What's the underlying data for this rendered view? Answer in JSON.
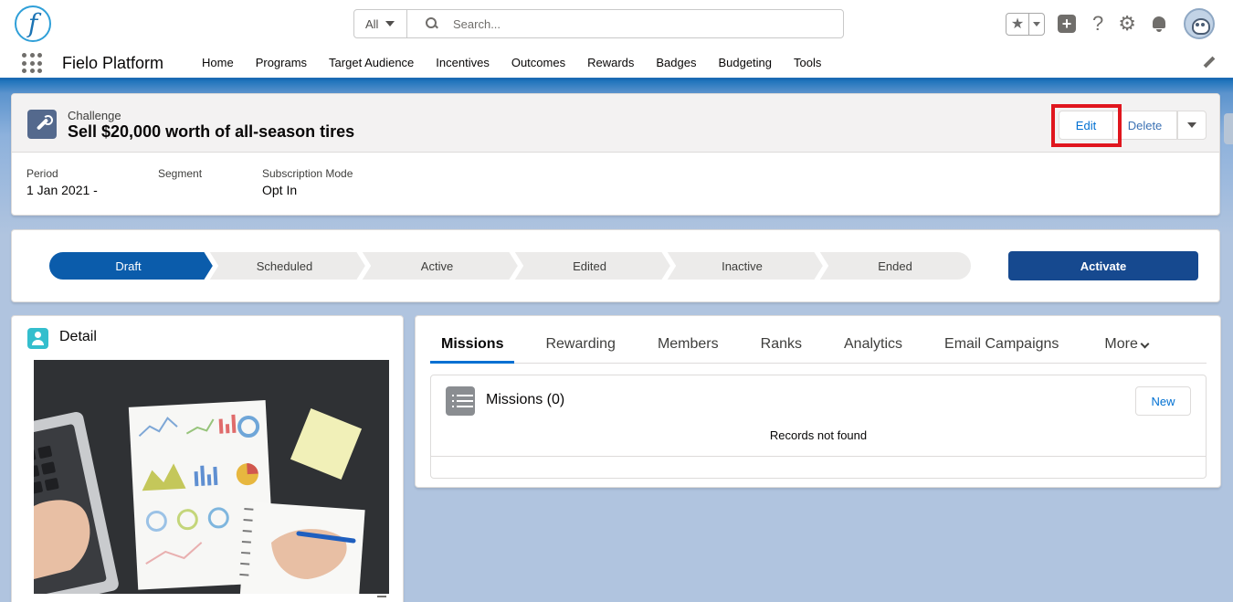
{
  "app": {
    "logo_letter": "f",
    "name": "Fielo Platform"
  },
  "search": {
    "scope": "All",
    "placeholder": "Search..."
  },
  "nav": {
    "items": [
      "Home",
      "Programs",
      "Target Audience",
      "Incentives",
      "Outcomes",
      "Rewards",
      "Badges",
      "Budgeting",
      "Tools"
    ]
  },
  "header_icons": [
    "favorites-star-icon",
    "plus-icon",
    "help-icon",
    "gear-icon",
    "bell-icon",
    "avatar"
  ],
  "record": {
    "type": "Challenge",
    "title": "Sell $20,000 worth of all-season tires",
    "actions": {
      "edit": "Edit",
      "delete": "Delete"
    },
    "fields": [
      {
        "label": "Period",
        "value": "1 Jan 2021 -"
      },
      {
        "label": "Segment",
        "value": ""
      },
      {
        "label": "Subscription Mode",
        "value": "Opt In"
      }
    ]
  },
  "path": {
    "stages": [
      "Draft",
      "Scheduled",
      "Active",
      "Edited",
      "Inactive",
      "Ended"
    ],
    "current_stage": "Draft",
    "action_label": "Activate"
  },
  "detail": {
    "title": "Detail"
  },
  "related": {
    "tabs": [
      "Missions",
      "Rewarding",
      "Members",
      "Ranks",
      "Analytics",
      "Email Campaigns"
    ],
    "active_tab": "Missions",
    "more_label": "More",
    "list_title": "Missions (0)",
    "new_label": "New",
    "empty_message": "Records not found"
  },
  "colors": {
    "brand_blue": "#0070d2",
    "path_current": "#0b5cab",
    "activate": "#16498f",
    "highlight": "#e0161e"
  }
}
